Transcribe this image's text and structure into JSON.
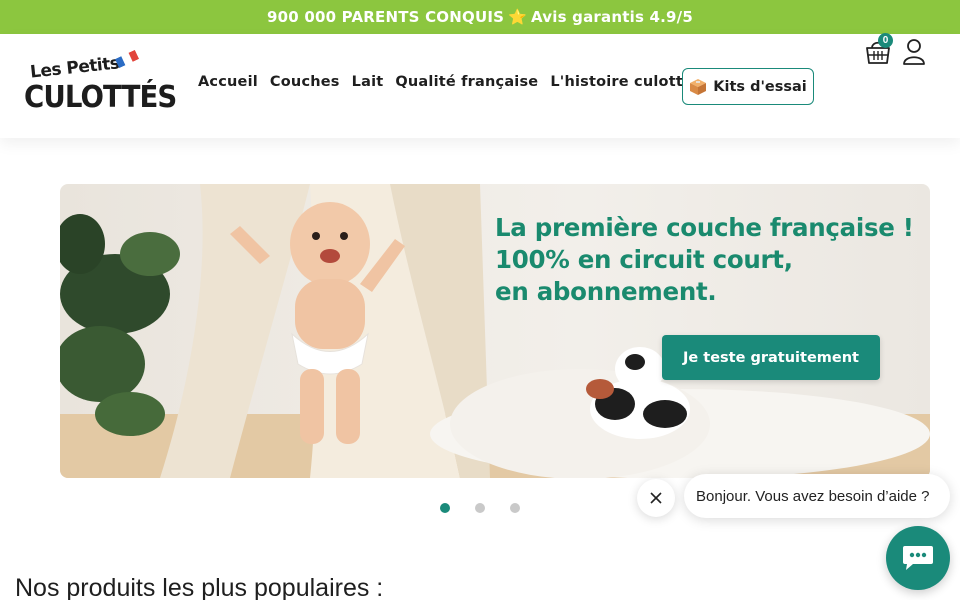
{
  "topbar": {
    "text_left": "900 000 PARENTS CONQUIS",
    "separator": "⭐",
    "text_right": "Avis garantis 4.9/5",
    "bg_color": "#8cc63f"
  },
  "logo": {
    "line1": "Les Petits",
    "line2": "CULOTTÉS"
  },
  "nav": {
    "items": [
      "Accueil",
      "Couches",
      "Lait",
      "Qualité française",
      "L'histoire culottée"
    ]
  },
  "kits": {
    "label": "Kits d'essai",
    "icon": "box-icon"
  },
  "cart": {
    "count": "0",
    "icon": "basket-icon"
  },
  "account": {
    "icon": "user-icon"
  },
  "hero": {
    "title_lines": [
      "La première couche française !",
      "100% en circuit court,",
      "en abonnement."
    ],
    "cta_label": "Je teste gratuitement",
    "accent_color": "#1a8a6e"
  },
  "carousel": {
    "slides": 3,
    "active": 1
  },
  "section": {
    "title": "Nos produits les plus populaires :"
  },
  "chat": {
    "message": "Bonjour. Vous avez besoin d’aide ?",
    "close_icon": "close-icon",
    "button_icon": "chat-icon",
    "color": "#1a8a7a"
  }
}
